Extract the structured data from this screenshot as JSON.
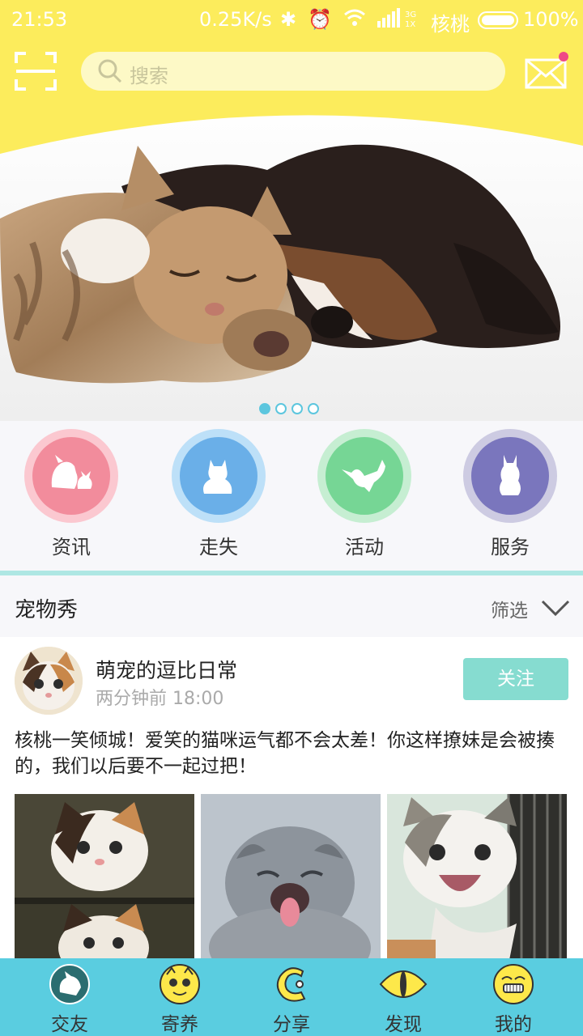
{
  "status_bar": {
    "time": "21:53",
    "speed": "0.25K/s",
    "carrier": "核桃",
    "battery_percent": "100%"
  },
  "header": {
    "search_placeholder": "搜索",
    "accent_color": "#fcec5c",
    "icons": [
      "scan-icon",
      "search-icon",
      "mail-icon"
    ]
  },
  "banner": {
    "slide_count": 4,
    "active_slide": 1
  },
  "categories": [
    {
      "label": "资讯",
      "icon": "dog-cat-icon",
      "color": "#f28c9c",
      "ring": "#fbc8d0"
    },
    {
      "label": "走失",
      "icon": "sitting-cat-icon",
      "color": "#6aafe8",
      "ring": "#bde0f8"
    },
    {
      "label": "活动",
      "icon": "leaping-cat-icon",
      "color": "#76d695",
      "ring": "#c6eed2"
    },
    {
      "label": "服务",
      "icon": "standing-cat-icon",
      "color": "#7a76bd",
      "ring": "#cdcbe2"
    }
  ],
  "section": {
    "title": "宠物秀",
    "filter_label": "筛选"
  },
  "post": {
    "user": "萌宠的逗比日常",
    "time": "两分钟前 18:00",
    "follow_label": "关注",
    "text": "核桃一笑倾城！爱笑的猫咪运气都不会太差！你这样撩妹是会被揍的，我们以后要不一起过把！"
  },
  "tabbar": {
    "color": "#5acde0",
    "tabs": [
      {
        "label": "交友",
        "icon": "friends-icon"
      },
      {
        "label": "寄养",
        "icon": "foster-icon"
      },
      {
        "label": "分享",
        "icon": "share-icon"
      },
      {
        "label": "发现",
        "icon": "discover-icon"
      },
      {
        "label": "我的",
        "icon": "profile-icon"
      }
    ]
  }
}
